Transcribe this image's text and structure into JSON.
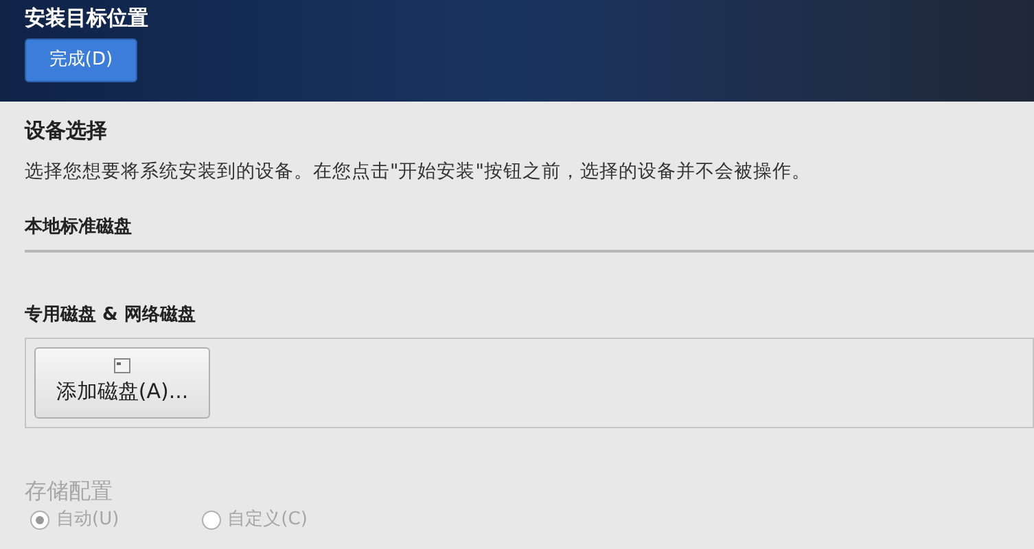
{
  "header": {
    "title": "安装目标位置",
    "done_button": "完成(D)"
  },
  "device_selection": {
    "heading": "设备选择",
    "description": "选择您想要将系统安装到的设备。在您点击\"开始安装\"按钮之前，选择的设备并不会被操作。"
  },
  "local_disks": {
    "heading": "本地标准磁盘"
  },
  "special_disks": {
    "heading": "专用磁盘 & 网络磁盘",
    "add_button": "添加磁盘(A)..."
  },
  "storage_config": {
    "heading": "存储配置",
    "disabled": true,
    "options": [
      {
        "label": "自动(U)",
        "selected": true
      },
      {
        "label": "自定义(C)",
        "selected": false
      }
    ]
  }
}
